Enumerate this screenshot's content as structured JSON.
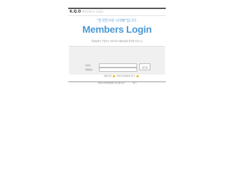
{
  "brand": {
    "logo": "K.Q.O",
    "sub": "Members Login"
  },
  "welcome": "\"한국연구원 시대평\"입니다.",
  "title": "Members Login",
  "description": "회원님께서 가입하신 아이디와 비밀번호를 입력해 주십시오",
  "form": {
    "id_label": "아이디",
    "pw_label": "비밀번호",
    "id_value": "",
    "pw_value": "",
    "login_button": "로그인",
    "join_label": "회원가입",
    "find_label": "아이디/비밀번호 찾기"
  },
  "footer": {
    "forgot": "아이디/비밀번호를 잊으셨나요?",
    "find": "찾기"
  },
  "colors": {
    "accent": "#4a9ad6",
    "dot": "#e8b400"
  }
}
